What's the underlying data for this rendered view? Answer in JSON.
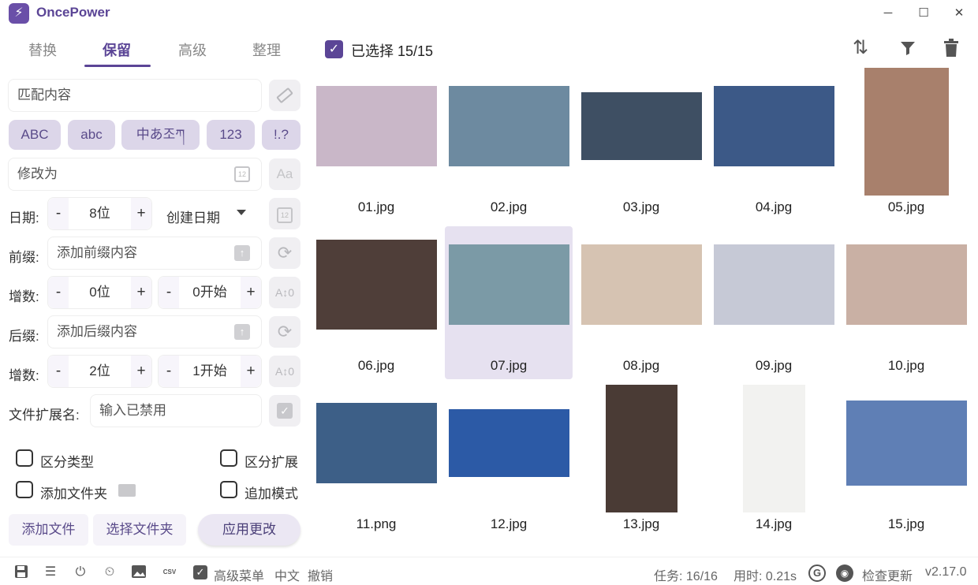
{
  "app": {
    "title": "OncePower",
    "logo": "⚡",
    "minimize": "─",
    "maximize": "☐",
    "close": "✕"
  },
  "tabs": [
    {
      "label": "替换"
    },
    {
      "label": "保留"
    },
    {
      "label": "高级"
    },
    {
      "label": "整理"
    }
  ],
  "form": {
    "match_placeholder": "匹配内容",
    "case_chips": [
      "ABC",
      "abc",
      "中あ조ཀ",
      "123",
      "!.?"
    ],
    "modify_placeholder": "修改为",
    "date_label": "日期:",
    "date_digits": "8位",
    "date_type": "创建日期",
    "prefix_label": "前缀:",
    "prefix_placeholder": "添加前缀内容",
    "prefix_inc_label": "增数:",
    "prefix_inc_digits": "0位",
    "prefix_inc_start": "0开始",
    "suffix_label": "后缀:",
    "suffix_placeholder": "添加后缀内容",
    "suffix_inc_label": "增数:",
    "suffix_inc_digits": "2位",
    "suffix_inc_start": "1开始",
    "ext_label": "文件扩展名:",
    "ext_placeholder": "输入已禁用",
    "minus": "-",
    "plus": "+"
  },
  "options": {
    "distinguish_type": "区分类型",
    "distinguish_ext": "区分扩展",
    "add_folder": "添加文件夹",
    "append_mode": "追加模式"
  },
  "buttons": {
    "add_files": "添加文件",
    "select_folder": "选择文件夹",
    "apply": "应用更改"
  },
  "header": {
    "selected": "已选择 15/15",
    "check": "✓"
  },
  "files": [
    {
      "name": "01.jpg",
      "selected": false,
      "color": "#c9b7c8"
    },
    {
      "name": "02.jpg",
      "selected": false,
      "color": "#6d8aa0"
    },
    {
      "name": "03.jpg",
      "selected": false,
      "color": "#3e4f63"
    },
    {
      "name": "04.jpg",
      "selected": false,
      "color": "#3c5987"
    },
    {
      "name": "05.jpg",
      "selected": false,
      "color": "#a8806c"
    },
    {
      "name": "06.jpg",
      "selected": false,
      "color": "#4f3e39"
    },
    {
      "name": "07.jpg",
      "selected": true,
      "color": "#7b9aa6"
    },
    {
      "name": "08.jpg",
      "selected": false,
      "color": "#d6c3b2"
    },
    {
      "name": "09.jpg",
      "selected": false,
      "color": "#c6c9d6"
    },
    {
      "name": "10.jpg",
      "selected": false,
      "color": "#c9b0a4"
    },
    {
      "name": "11.png",
      "selected": false,
      "color": "#3d5f87"
    },
    {
      "name": "12.jpg",
      "selected": false,
      "color": "#2c5aa6"
    },
    {
      "name": "13.jpg",
      "selected": false,
      "color": "#4a3b35"
    },
    {
      "name": "14.jpg",
      "selected": false,
      "color": "#f2f2f0"
    },
    {
      "name": "15.jpg",
      "selected": false,
      "color": "#5f7fb5"
    }
  ],
  "statusbar": {
    "advanced_menu": "高级菜单",
    "language": "中文",
    "undo": "撤销",
    "tasks": "任务: 16/16",
    "time": "用时: 0.21s",
    "check_update": "检查更新",
    "version": "v2.17.0"
  },
  "colors": {
    "accent": "#5b4596",
    "chip_bg": "#dcd6e9",
    "selected_bg": "#e6e1f0"
  }
}
